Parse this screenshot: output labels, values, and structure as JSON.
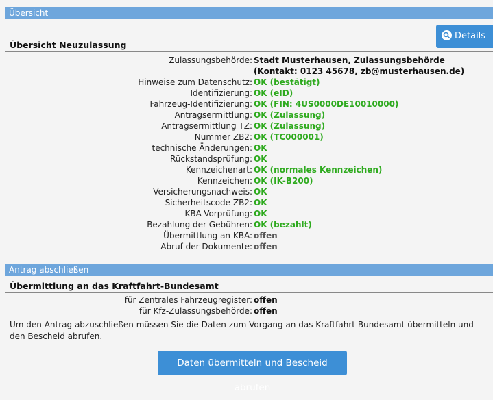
{
  "overview": {
    "bar_title": "Übersicht",
    "heading": "Übersicht Neuzulassung",
    "details_label": "Details",
    "rows": [
      {
        "label": "Zulassungsbehörde:",
        "value": "Stadt Musterhausen, Zulassungsbehörde (Kontakt: 0123 45678, zb@musterhausen.de)",
        "status": "dark"
      },
      {
        "label": "Hinweise zum Datenschutz:",
        "value": "OK (bestätigt)",
        "status": "ok"
      },
      {
        "label": "Identifizierung:",
        "value": "OK (eID)",
        "status": "ok"
      },
      {
        "label": "Fahrzeug-Identifizierung:",
        "value": "OK (FIN: 4US0000DE10010000)",
        "status": "ok"
      },
      {
        "label": "Antragsermittlung:",
        "value": "OK (Zulassung)",
        "status": "ok"
      },
      {
        "label": "Antragsermittlung TZ:",
        "value": "OK (Zulassung)",
        "status": "ok"
      },
      {
        "label": "Nummer ZB2:",
        "value": "OK (TC000001)",
        "status": "ok"
      },
      {
        "label": "technische Änderungen:",
        "value": "OK",
        "status": "ok"
      },
      {
        "label": "Rückstandsprüfung:",
        "value": "OK",
        "status": "ok"
      },
      {
        "label": "Kennzeichenart:",
        "value": "OK (normales Kennzeichen)",
        "status": "ok"
      },
      {
        "label": "Kennzeichen:",
        "value": "OK (IK-B200)",
        "status": "ok"
      },
      {
        "label": "Versicherungsnachweis:",
        "value": "OK",
        "status": "ok"
      },
      {
        "label": "Sicherheitscode ZB2:",
        "value": "OK",
        "status": "ok"
      },
      {
        "label": "KBA-Vorprüfung:",
        "value": "OK",
        "status": "ok"
      },
      {
        "label": "Bezahlung der Gebühren:",
        "value": "OK (bezahlt)",
        "status": "ok"
      },
      {
        "label": "Übermittlung an KBA:",
        "value": "offen",
        "status": "open"
      },
      {
        "label": "Abruf der Dokumente:",
        "value": "offen",
        "status": "open"
      }
    ]
  },
  "finish": {
    "bar_title": "Antrag abschließen",
    "heading": "Übermittlung an das Kraftfahrt-Bundesamt",
    "rows": [
      {
        "label": "für Zentrales Fahrzeugregister:",
        "value": "offen"
      },
      {
        "label": "für Kfz-Zulassungsbehörde:",
        "value": "offen"
      }
    ],
    "note": "Um den Antrag abzuschließen müssen Sie die Daten zum Vorgang an das Kraftfahrt-Bundesamt übermitteln und den Bescheid abrufen.",
    "button_label": "Daten übermitteln und Bescheid abrufen"
  },
  "colors": {
    "accent": "#3d8fd6",
    "bar": "#6ea6dc",
    "ok": "#2eaa1e"
  },
  "icons": {
    "details": "search-icon"
  }
}
